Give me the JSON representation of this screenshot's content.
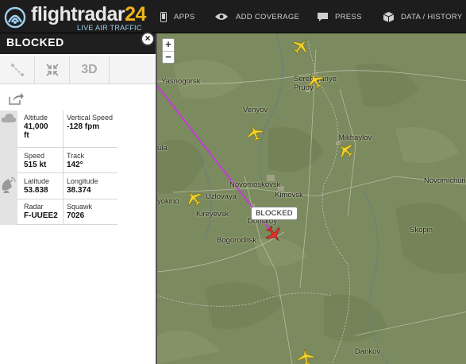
{
  "header": {
    "logo_text": "flightradar",
    "logo_number": "24",
    "logo_tagline": "LIVE AIR TRAFFIC",
    "nav": [
      {
        "label": "APPS",
        "icon": "phone-icon"
      },
      {
        "label": "ADD COVERAGE",
        "icon": "eye-icon"
      },
      {
        "label": "PRESS",
        "icon": "chat-icon"
      },
      {
        "label": "DATA / HISTORY",
        "icon": "cube-icon"
      }
    ]
  },
  "panel": {
    "title": "BLOCKED",
    "close_label": "×",
    "tools": {
      "route_icon": "route-icon",
      "collapse_icon": "collapse-icon",
      "three_d_label": "3D"
    },
    "share_icon": "share-icon",
    "fields": {
      "altitude_label": "Altitude",
      "altitude_value": "41,000",
      "altitude_unit": "ft",
      "vspeed_label": "Vertical Speed",
      "vspeed_value": "-128 fpm",
      "speed_label": "Speed",
      "speed_value": "515 kt",
      "track_label": "Track",
      "track_value": "142°",
      "latitude_label": "Latitude",
      "latitude_value": "53.838",
      "longitude_label": "Longitude",
      "longitude_value": "38.374",
      "radar_label": "Radar",
      "radar_value": "F-UUEE2",
      "squawk_label": "Squawk",
      "squawk_value": "7026"
    }
  },
  "map": {
    "zoom_in": "+",
    "zoom_out": "−",
    "selected_callout": "BLOCKED",
    "route_color": "#c43bd6",
    "plane_color": "#f2d22c",
    "selected_plane_color": "#e8322a",
    "cities": [
      "Yasnogorsk",
      "Serebryanye Prudy",
      "Venyov",
      "Mikhaylov",
      "Novomoskovsk",
      "Kimovsk",
      "Novomichurinsk",
      "ula",
      "Uzlovaya",
      "yokino",
      "Kireyevsk",
      "Donskoy",
      "Skopin",
      "Bogoroditsk",
      "Dankov"
    ]
  }
}
